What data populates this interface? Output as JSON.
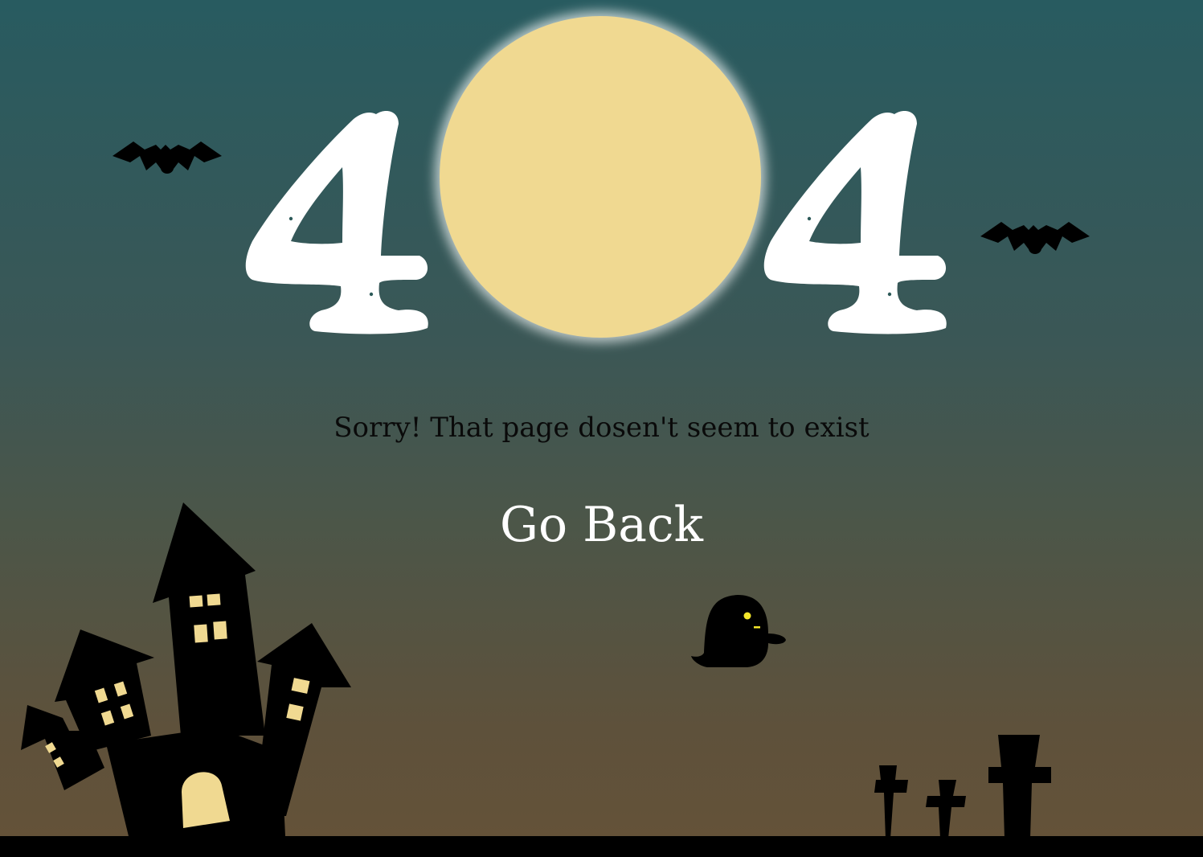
{
  "error": {
    "code_left": "4",
    "code_right": "4",
    "message": "Sorry! That page dosen't seem to exist"
  },
  "actions": {
    "go_back_label": "Go Back"
  },
  "colors": {
    "sky_top": "#285b60",
    "sky_bottom": "#655238",
    "moon": "#f0d991",
    "silhouette": "#000000",
    "window_light": "#f0d991",
    "ghost_eye": "#f3e62a",
    "digit": "#ffffff"
  },
  "icons": [
    "bat-icon",
    "ghost-icon",
    "haunted-house-icon",
    "gravestone-icon",
    "moon-icon"
  ]
}
